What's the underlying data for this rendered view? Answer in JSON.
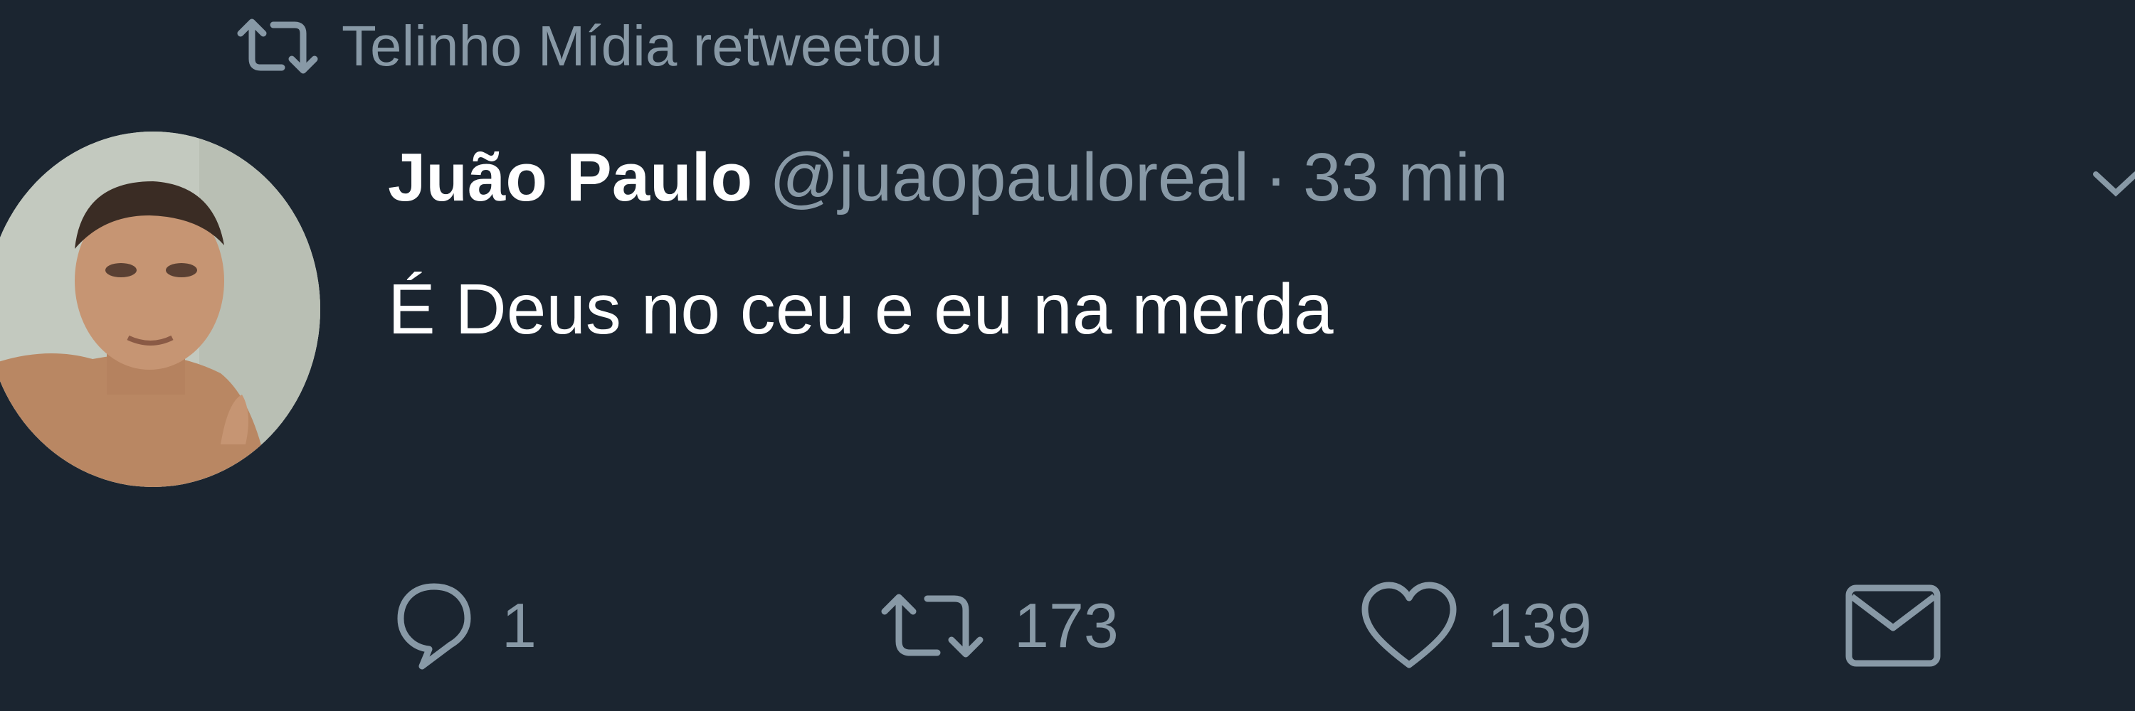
{
  "retweet_banner": {
    "icon": "retweet-icon",
    "text": "Telinho Mídia retweetou"
  },
  "tweet": {
    "avatar": "user-avatar-photo",
    "display_name": "Juão Paulo",
    "handle": "@juaopauloreal",
    "separator": "·",
    "timestamp": "33 min",
    "caret_icon": "chevron-down-icon",
    "text": "É Deus no ceu e eu na merda"
  },
  "actions": {
    "reply": {
      "icon": "reply-icon",
      "count": "1"
    },
    "retweet": {
      "icon": "retweet-icon",
      "count": "173"
    },
    "like": {
      "icon": "heart-icon",
      "count": "139"
    },
    "message": {
      "icon": "envelope-icon"
    }
  },
  "colors": {
    "background": "#1b2530",
    "primary_text": "#ffffff",
    "secondary_text": "#8899a6"
  }
}
